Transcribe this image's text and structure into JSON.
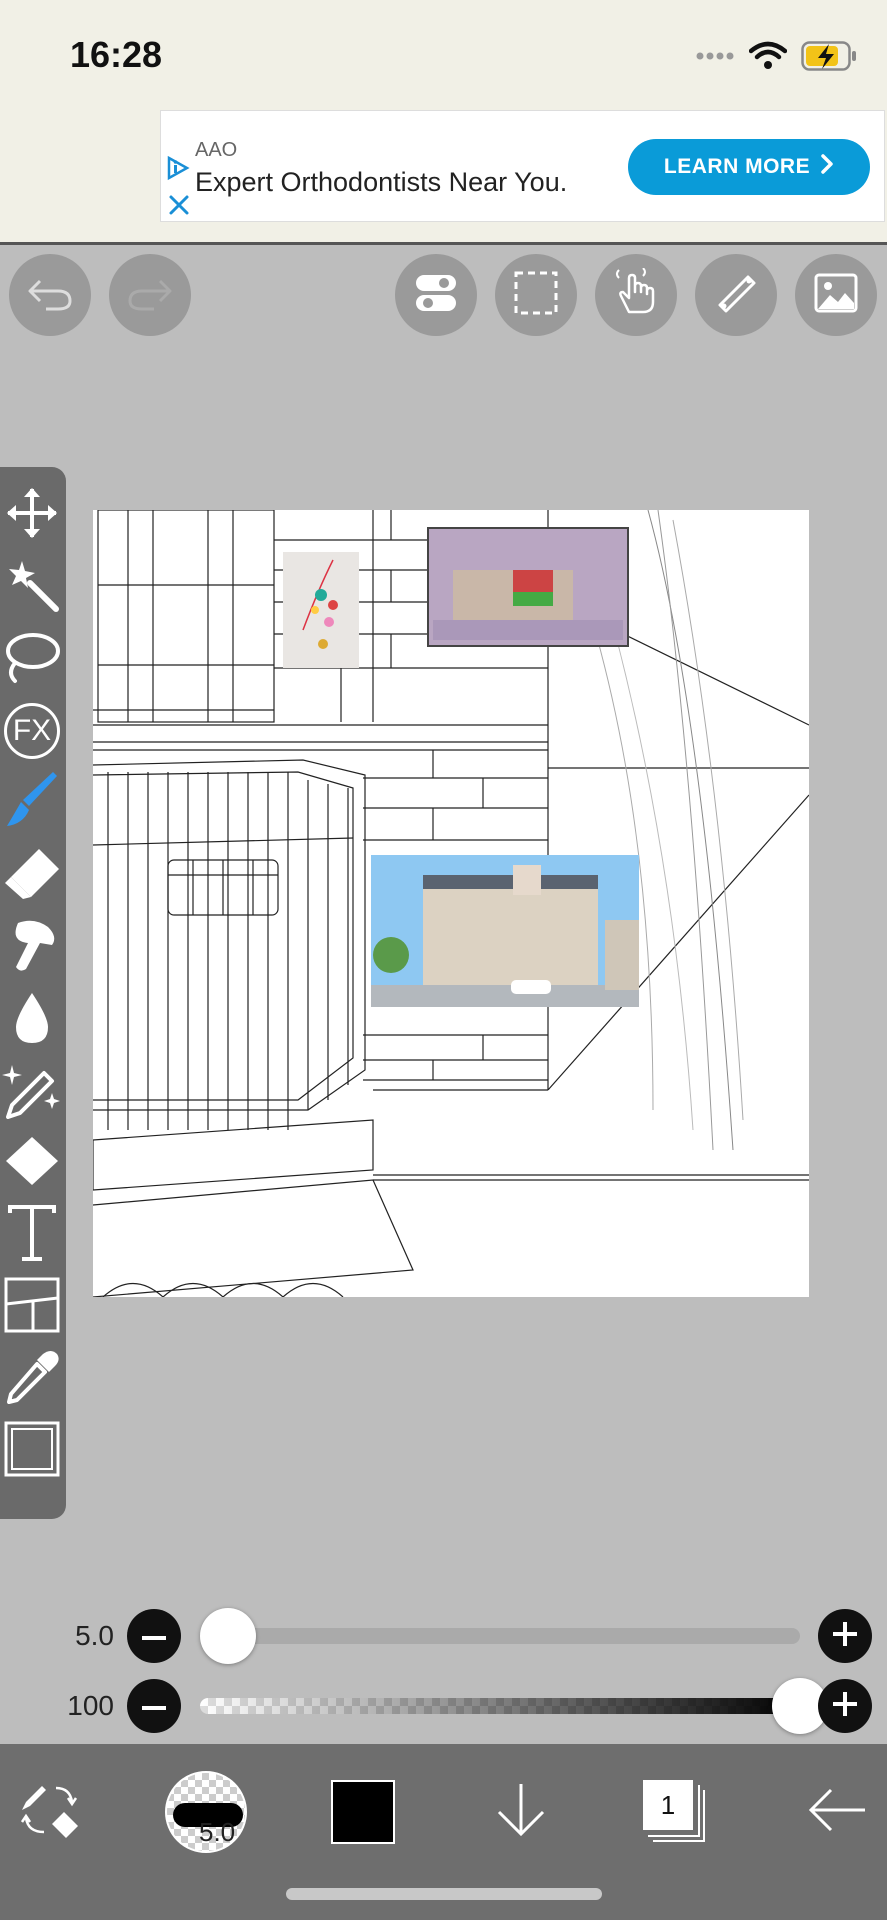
{
  "status": {
    "time": "16:28"
  },
  "ad": {
    "brand": "AAO",
    "headline": "Expert Orthodontists Near You.",
    "cta": "LEARN MORE"
  },
  "top_toolbar": {
    "buttons": [
      "undo-icon",
      "redo-icon",
      "toggle-icon",
      "selection-icon",
      "hand-icon",
      "ruler-icon",
      "image-icon"
    ]
  },
  "left_toolbar": {
    "tools": [
      "move-icon",
      "magic-wand-icon",
      "lasso-icon",
      "fx-icon",
      "brush-icon",
      "eraser-icon",
      "smudge-icon",
      "blur-icon",
      "sparkle-brush-icon",
      "fill-icon",
      "text-icon",
      "frame-divider-icon",
      "eyedropper-icon",
      "canvas-icon"
    ],
    "fx_label": "FX",
    "active_tool": "brush-icon",
    "accent_color": "#2f95ee"
  },
  "brush_size": {
    "value": "5.0",
    "level": 0.0
  },
  "opacity": {
    "value": "100",
    "level": 1.0
  },
  "bottom_bar": {
    "brush_size_label": "5.0",
    "color": "#000000",
    "layer_count": "1"
  }
}
